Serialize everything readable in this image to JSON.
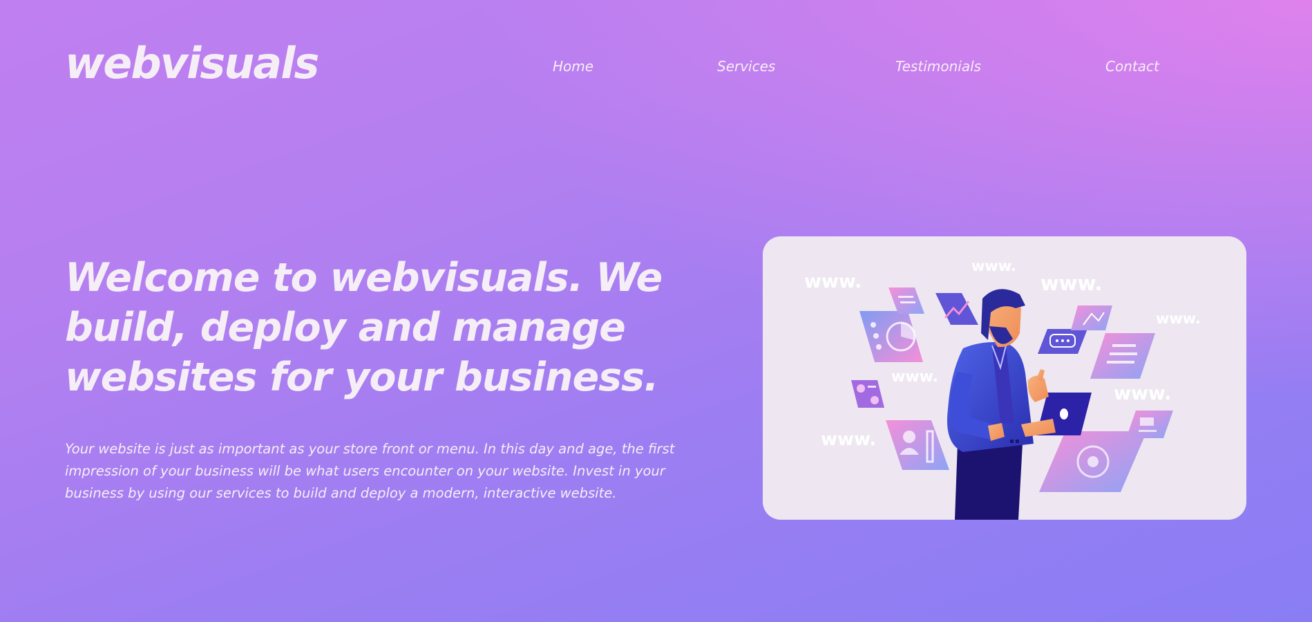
{
  "brand": {
    "logo": "webvisuals"
  },
  "nav": {
    "items": [
      {
        "label": "Home"
      },
      {
        "label": "Services"
      },
      {
        "label": "Testimonials"
      },
      {
        "label": "Contact"
      }
    ]
  },
  "hero": {
    "title": "Welcome to webvisuals. We build, deploy and manage websites for your business.",
    "description": "Your website is just as important as your store front or menu. In this day and age, the first impression of your business will be what users encounter on your website. Invest in your business by using our services to build and deploy a modern, interactive website."
  },
  "illustration": {
    "labels": [
      "www.",
      "www.",
      "www.",
      "www.",
      "www.",
      "www.",
      "www."
    ]
  },
  "colors": {
    "bg_top": "#c07ff0",
    "bg_bottom": "#8a7df4",
    "bg_corner_pink": "#f082eb",
    "text": "#f6eef6",
    "card_bg": "#eee7f1"
  }
}
